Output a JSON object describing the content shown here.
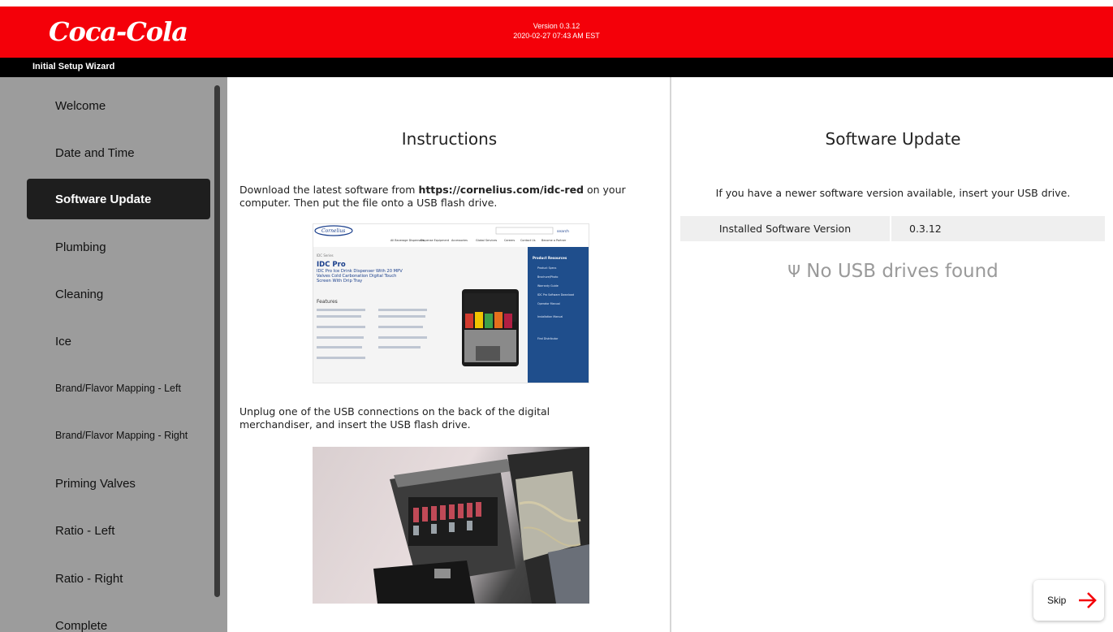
{
  "header": {
    "logo": "Coca-Cola",
    "version": "Version 0.3.12",
    "datetime": "2020-02-27 07:43 AM EST",
    "wizard_title": "Initial Setup Wizard",
    "colors": {
      "brand_red": "#f40009",
      "bar_black": "#000000"
    }
  },
  "sidebar": {
    "items": [
      {
        "label": "Welcome"
      },
      {
        "label": "Date and Time"
      },
      {
        "label": "Software Update"
      },
      {
        "label": "Plumbing"
      },
      {
        "label": "Cleaning"
      },
      {
        "label": "Ice"
      },
      {
        "label": "Brand/Flavor Mapping - Left"
      },
      {
        "label": "Brand/Flavor Mapping - Right"
      },
      {
        "label": "Priming Valves"
      },
      {
        "label": "Ratio - Left"
      },
      {
        "label": "Ratio - Right"
      },
      {
        "label": "Complete"
      }
    ],
    "active": "Software Update"
  },
  "instructions": {
    "title": "Instructions",
    "step1_prefix": "Download the latest software from ",
    "step1_link": "https://cornelius.com/idc-red",
    "step1_suffix": " on your computer. Then put the file onto a USB flash drive.",
    "website": {
      "brand": "Cornelius",
      "search_label": "search",
      "nav": [
        "All Beverage Dispensers",
        "Dispense Equipment",
        "Accessories",
        "Global Services",
        "Careers",
        "Contact Us",
        "Become a Partner"
      ],
      "category": "IDC Series",
      "product": "IDC Pro",
      "headline": "IDC Pro Ice Drink Dispenser With 20 MPV Valves Cold Carbonation Digital Touch Screen With Drip Tray",
      "features_title": "Features",
      "side_title": "Product Resources",
      "side_links": [
        "Product Specs",
        "Brochure/Photo",
        "Warranty Guide",
        "IDC Pro Software Download",
        "Operator Manual",
        "Installation Manual",
        "Find Distributor"
      ]
    },
    "step2": "Unplug one of the USB connections on the back of the digital merchandiser, and insert the USB flash drive."
  },
  "software_update": {
    "title": "Software Update",
    "prompt": "If you have a newer software version available, insert your USB drive.",
    "installed_label": "Installed Software Version",
    "installed_value": "0.3.12",
    "usb_icon": "usb-icon",
    "usb_status": "No USB drives found"
  },
  "skip": {
    "label": "Skip",
    "arrow_color": "#f40009"
  }
}
